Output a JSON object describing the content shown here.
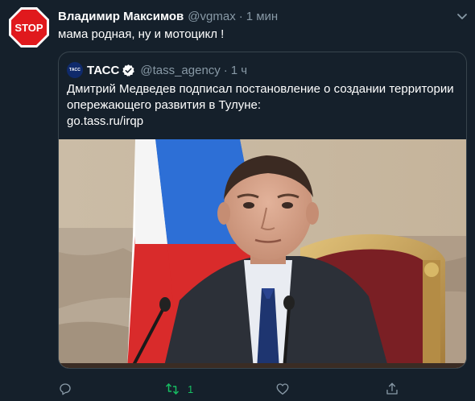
{
  "tweet": {
    "author_name": "Владимир Максимов",
    "author_handle": "@vgmax",
    "separator": "·",
    "time": "1 мин",
    "avatar_icon": "stop-sign-icon",
    "avatar_text": "STOP",
    "text": "мама родная, ну и мотоцикл !"
  },
  "quoted": {
    "logo_text": "ТАСС",
    "name": "ТАСС",
    "verified_icon": "verified-badge-icon",
    "handle": "@tass_agency",
    "separator": "·",
    "time": "1 ч",
    "text_line1": "Дмитрий Медведев подписал постановление о создании территории",
    "text_line2": "опережающего развития в Тулуне:",
    "link": "go.tass.ru/irqp",
    "image_icon": "photo-man-at-microphone"
  },
  "actions": {
    "reply_icon": "reply-icon",
    "retweet_icon": "retweet-icon",
    "retweet_count": "1",
    "retweeted": true,
    "like_icon": "heart-icon",
    "share_icon": "share-icon"
  },
  "colors": {
    "background": "#15202b",
    "secondary_text": "#8899a6",
    "border": "#38444d",
    "retweet_active": "#17bf63",
    "verified": "#1da1f2",
    "stop_red": "#e0191d"
  }
}
